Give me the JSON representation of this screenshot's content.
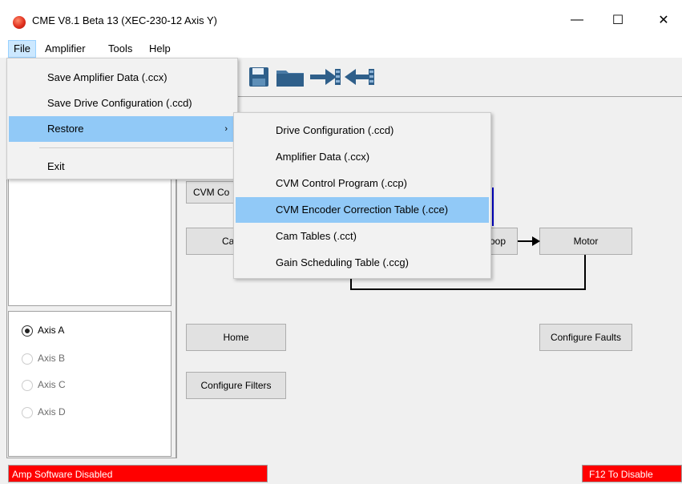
{
  "window": {
    "title": "CME V8.1 Beta 13 (XEC-230-12 Axis Y)",
    "minimize": "—",
    "maximize": "☐",
    "close": "✕"
  },
  "menubar": {
    "items": [
      {
        "label": "File"
      },
      {
        "label": "Amplifier"
      },
      {
        "label": "Tools"
      },
      {
        "label": "Help"
      }
    ]
  },
  "file_menu": {
    "items": [
      {
        "label": "Save Amplifier Data (.ccx)"
      },
      {
        "label": "Save Drive Configuration (.ccd)"
      },
      {
        "label": "Restore",
        "submenu_arrow": "›"
      },
      {
        "label": "Exit"
      }
    ]
  },
  "restore_menu": {
    "items": [
      {
        "label": "Drive Configuration (.ccd)"
      },
      {
        "label": "Amplifier Data (.ccx)"
      },
      {
        "label": "CVM Control Program (.ccp)"
      },
      {
        "label": "CVM Encoder Correction Table (.cce)"
      },
      {
        "label": "Cam Tables (.cct)"
      },
      {
        "label": "Gain Scheduling Table (.ccg)"
      }
    ]
  },
  "toolbar": {
    "icons": [
      "save-disk-icon",
      "open-folder-icon",
      "download-arrow-icon",
      "upload-arrow-icon"
    ]
  },
  "main": {
    "cvm_button": "CVM Co",
    "ca_button": "Ca",
    "loop_button": "oop",
    "motor_button": "Motor",
    "home_button": "Home",
    "configure_faults_button": "Configure Faults",
    "configure_filters_button": "Configure Filters"
  },
  "axes": {
    "items": [
      {
        "label": "Axis A",
        "selected": true,
        "enabled": true
      },
      {
        "label": "Axis B",
        "selected": false,
        "enabled": false
      },
      {
        "label": "Axis C",
        "selected": false,
        "enabled": false
      },
      {
        "label": "Axis D",
        "selected": false,
        "enabled": false
      }
    ]
  },
  "status": {
    "left": "Amp Software Disabled",
    "right": "F12 To Disable"
  },
  "colors": {
    "status_alert": "#ff0000",
    "menu_highlight": "#91c9f7",
    "toolbar_icon": "#2f5f8a"
  }
}
